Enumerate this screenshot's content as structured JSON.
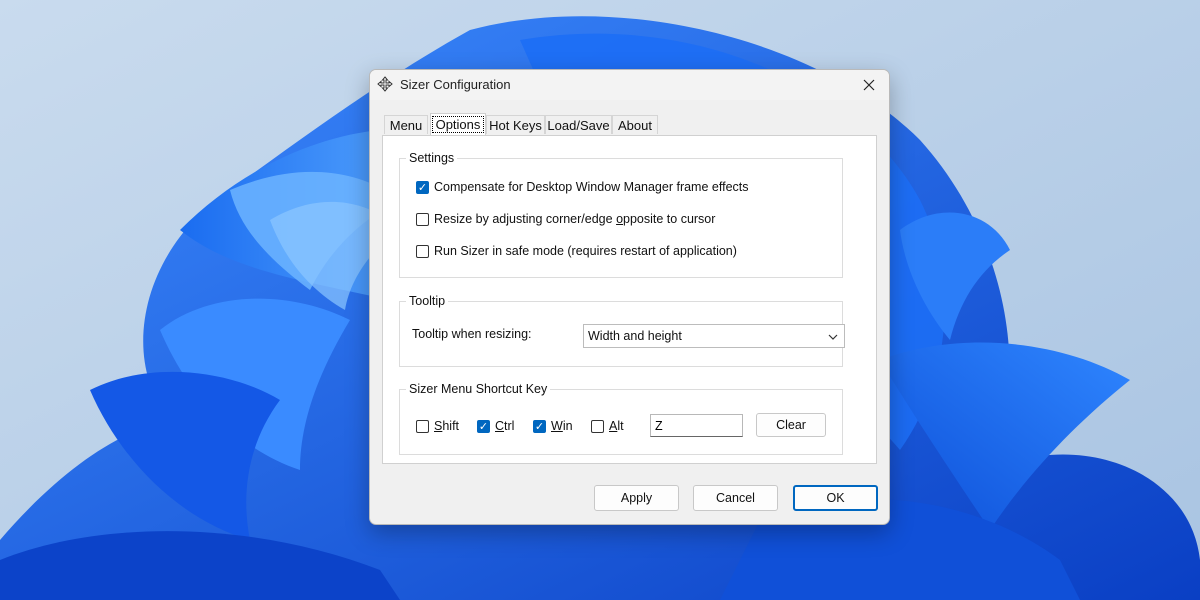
{
  "window": {
    "title": "Sizer Configuration",
    "icon": "sizer-move-icon",
    "close_icon": "close-icon"
  },
  "tabs": [
    {
      "label": "Menu",
      "active": false
    },
    {
      "label": "Options",
      "active": true
    },
    {
      "label": "Hot Keys",
      "active": false
    },
    {
      "label": "Load/Save",
      "active": false
    },
    {
      "label": "About",
      "active": false
    }
  ],
  "settings": {
    "title": "Settings",
    "items": [
      {
        "label": "Compensate for Desktop Window Manager frame effects",
        "checked": true
      },
      {
        "label_pre": "Resize by adjusting corner/edge ",
        "label_ul": "o",
        "label_post": "pposite to cursor",
        "checked": false
      },
      {
        "label": "Run Sizer in safe mode (requires restart of application)",
        "checked": false
      }
    ]
  },
  "tooltip": {
    "title": "Tooltip",
    "label": "Tooltip when resizing:",
    "selected": "Width and height"
  },
  "shortcut": {
    "title": "Sizer Menu Shortcut Key",
    "modifiers": [
      {
        "ul": "S",
        "rest": "hift",
        "checked": false
      },
      {
        "ul": "C",
        "rest": "trl",
        "checked": true
      },
      {
        "ul": "W",
        "rest": "in",
        "checked": true
      },
      {
        "ul": "A",
        "rest": "lt",
        "checked": false
      }
    ],
    "key_value": "Z",
    "clear_label": "Clear"
  },
  "footer": {
    "apply_label": "Apply",
    "cancel_label": "Cancel",
    "ok_label": "OK"
  },
  "colors": {
    "accent": "#0067c0",
    "dialog_bg": "#f0f0f0",
    "wallpaper_blue": "#1565e0"
  }
}
